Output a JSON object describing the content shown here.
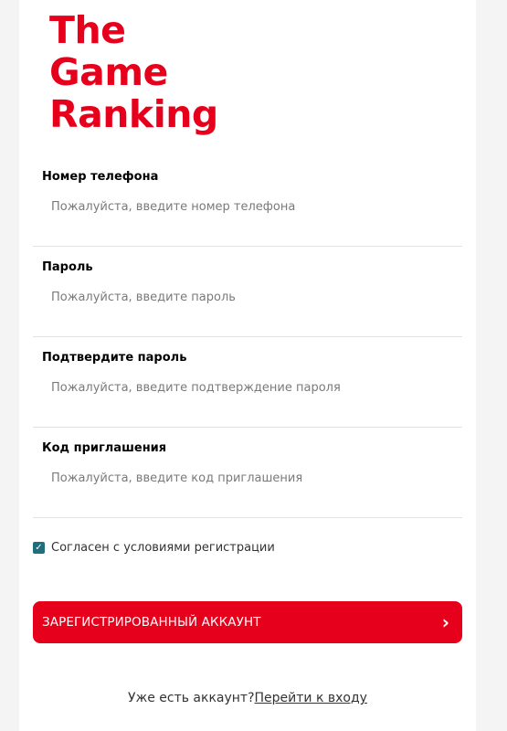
{
  "logo": {
    "line1": "The",
    "line2": "Game",
    "line3": "Ranking"
  },
  "form": {
    "fields": [
      {
        "label": "Номер телефона",
        "placeholder": "Пожалуйста, введите номер телефона",
        "value": ""
      },
      {
        "label": "Пароль",
        "placeholder": "Пожалуйста, введите пароль",
        "value": ""
      },
      {
        "label": "Подтвердите пароль",
        "placeholder": "Пожалуйста, введите подтверждение пароля",
        "value": ""
      },
      {
        "label": "Код приглашения",
        "placeholder": "Пожалуйста, введите код приглашения",
        "value": ""
      }
    ],
    "agree_label": "Согласен с условиями регистрации",
    "agree_checked": true,
    "register_label": "ЗАРЕГИСТРИРОВАННЫЙ АККАУНТ",
    "register_icon": "chevron-right-icon"
  },
  "footer": {
    "prompt": "Уже есть аккаунт?",
    "login_link": "Перейти к входу"
  },
  "colors": {
    "brand": "#e6001b",
    "checkbox": "#1e6e7e",
    "divider": "#e2e2e2"
  }
}
